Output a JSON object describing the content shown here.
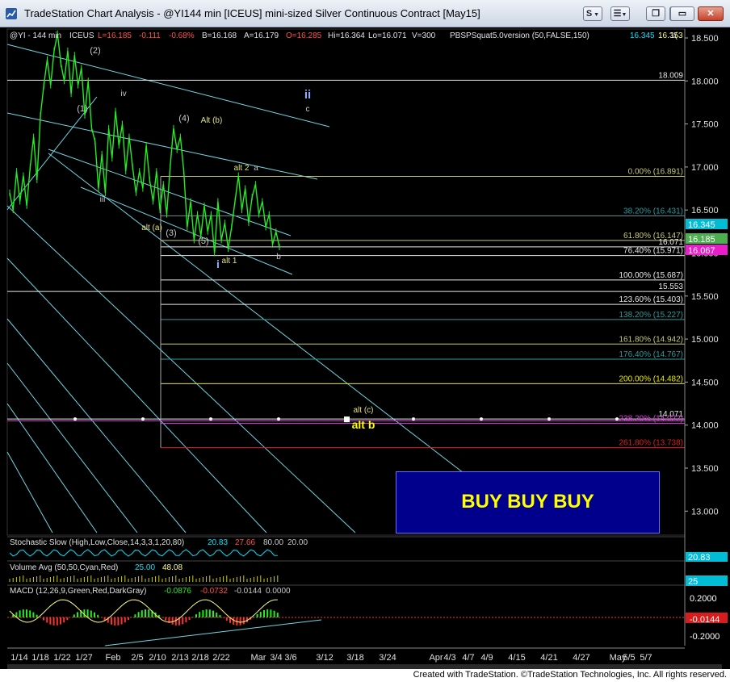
{
  "window": {
    "title": "TradeStation Chart Analysis - @YI144 min [ICEUS] mini-sized Silver Continuous Contract [May15]",
    "buttons": {
      "s_label": "S",
      "menu_label": "",
      "min_label": "",
      "max_label": "",
      "close_label": ""
    }
  },
  "header": {
    "symbol": "@YI - 144 min",
    "exchange": "ICEUS",
    "last": "L=16.185",
    "change": "-0.111",
    "pct_change": "-0.68%",
    "bid": "B=16.168",
    "ask": "A=16.179",
    "open": "O=16.285",
    "high": "Hi=16.364",
    "low": "Lo=16.071",
    "volume": "V=300",
    "indicator": "PBSPSquat5.0version (50,FALSE,150)",
    "ind_v1": "16.345",
    "ind_v2": "16.353",
    "ind_v3": "1("
  },
  "colors": {
    "background": "#000000",
    "price": "#22ee22",
    "channel": "#6fd7e3",
    "fib_white": "#e8e8e8",
    "fib_olive": "#c8c87a",
    "fib_teal": "#2e9a9a",
    "fib_yellow": "#e8e800",
    "fib_red": "#d82020",
    "magenta": "#e040e0",
    "wave_label": "#e0e080"
  },
  "chart_data": {
    "type": "line",
    "price_axis": {
      "ticks": [
        "18.500",
        "18.000",
        "17.500",
        "17.000",
        "16.500",
        "16.000",
        "15.500",
        "15.000",
        "14.500",
        "14.000",
        "13.500",
        "13.000"
      ],
      "ylim": [
        12.75,
        18.75
      ]
    },
    "date_axis": [
      "1/14",
      "1/18",
      "1/22",
      "1/27",
      "Feb",
      "2/5",
      "2/10",
      "2/13",
      "2/18",
      "2/22",
      "Mar",
      "3/4",
      "3/6",
      "3/12",
      "3/18",
      "3/24",
      "Apr",
      "4/3",
      "4/7",
      "4/9",
      "4/15",
      "4/21",
      "4/27",
      "May",
      "5/5",
      "5/7"
    ],
    "series": [
      {
        "values": [
          16.7,
          16.5,
          16.95,
          16.6,
          16.9,
          16.55,
          17.0,
          17.35,
          16.85,
          17.6,
          17.95,
          18.25,
          17.95,
          18.35,
          18.55,
          18.2,
          18.0,
          18.35,
          17.85,
          18.3,
          17.95,
          18.15,
          17.6,
          18.0,
          17.45,
          17.3,
          16.75,
          17.15,
          16.7,
          17.45,
          17.1,
          17.65,
          17.25,
          17.5,
          16.95,
          17.35,
          17.0,
          16.7,
          16.95,
          16.75,
          17.25,
          16.85,
          16.6,
          16.95,
          16.5,
          16.8,
          16.45,
          17.0,
          17.45,
          17.2,
          17.35,
          16.95,
          16.3,
          16.6,
          16.15,
          16.45,
          16.2,
          16.55,
          16.25,
          16.45,
          16.0,
          16.6,
          16.15,
          16.35,
          16.05,
          16.3,
          16.6,
          16.9,
          16.5,
          16.75,
          16.35,
          16.65,
          16.8,
          16.45,
          16.6,
          16.3,
          16.45,
          16.1,
          16.25,
          16.07
        ]
      }
    ],
    "levels": [
      {
        "label": "18.009",
        "value": 18.009
      },
      {
        "label": "0.00% (16.891)",
        "value": 16.891
      },
      {
        "label": "38.20% (16.431)",
        "value": 16.431
      },
      {
        "label": "61.80% (16.147)",
        "value": 16.147
      },
      {
        "label": "16.071",
        "value": 16.071
      },
      {
        "label": "76.40% (15.971)",
        "value": 15.971
      },
      {
        "label": "100.00% (15.687)",
        "value": 15.687
      },
      {
        "label": "15.553",
        "value": 15.553
      },
      {
        "label": "123.60% (15.403)",
        "value": 15.403
      },
      {
        "label": "138.20% (15.227)",
        "value": 15.227
      },
      {
        "label": "161.80% (14.942)",
        "value": 14.942
      },
      {
        "label": "176.40% (14.767)",
        "value": 14.767
      },
      {
        "label": "200.00% (14.482)",
        "value": 14.482
      },
      {
        "label": "14.071",
        "value": 14.071
      },
      {
        "label": "238.20% (14.022)",
        "value": 14.022
      },
      {
        "label": "261.80% (13.738)",
        "value": 13.738
      }
    ],
    "price_tags": [
      "16.345",
      "16.185",
      "16.067"
    ],
    "wave_labels": [
      "(2)",
      "(1)",
      "iv",
      "iii",
      "(4)",
      "Alt (b)",
      "alt (a)",
      "(3)",
      "(5)",
      "i",
      "alt 1",
      "alt 2",
      "a",
      "b",
      "ii",
      "c",
      "alt (c)",
      "alt b"
    ],
    "annotation": "BUY BUY BUY",
    "stochastic": {
      "title": "Stochastic Slow (High,Low,Close,14,3,3,1,20,80)",
      "values": [
        "20.83",
        "27.66",
        "80.00",
        "20.00"
      ],
      "axis_tag": "20.83"
    },
    "volume": {
      "title": "Volume Avg (50,50,Cyan,Red)",
      "values": [
        "25.00",
        "48.08"
      ],
      "axis_tag": "25"
    },
    "macd": {
      "title": "MACD (12,26,9,Green,Red,DarkGray)",
      "values": [
        "-0.0876",
        "-0.0732",
        "-0.0144",
        "0.0000"
      ],
      "axis_ticks": [
        "0.2000",
        "-0.0144",
        "-0.2000"
      ]
    }
  },
  "footer": {
    "text": "Created with TradeStation. ©TradeStation Technologies, Inc. All rights reserved."
  }
}
